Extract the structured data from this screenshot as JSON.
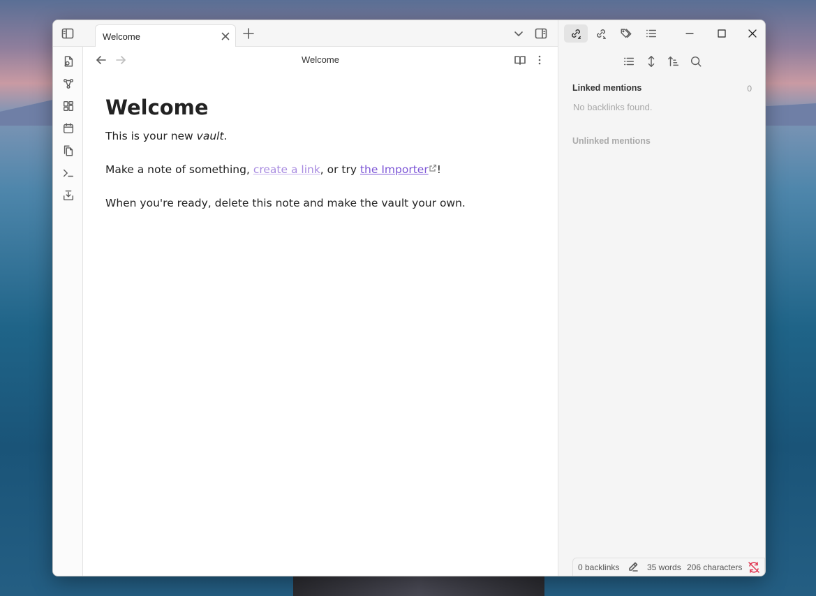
{
  "tabs": [
    {
      "title": "Welcome"
    }
  ],
  "editor": {
    "view_title": "Welcome",
    "heading": "Welcome",
    "p1_text": "This is your new ",
    "p1_em": "vault",
    "p1_end": ".",
    "p2_start": "Make a note of something, ",
    "p2_internal_link": "create a link",
    "p2_mid": ", or try ",
    "p2_external_link": "the Importer",
    "p2_end": "!",
    "p3": "When you're ready, delete this note and make the vault your own."
  },
  "backlinks_panel": {
    "linked_title": "Linked mentions",
    "linked_count": "0",
    "linked_empty": "No backlinks found.",
    "unlinked_title": "Unlinked mentions"
  },
  "statusbar": {
    "backlinks": "0 backlinks",
    "words": "35 words",
    "characters": "206 characters"
  },
  "icons": {
    "ribbon": [
      "switcher-icon",
      "graph-icon",
      "canvas-icon",
      "daily-note-icon",
      "templates-icon",
      "command-palette-icon",
      "importer-icon"
    ],
    "right_tabs": [
      "backlinks-icon",
      "outgoing-links-icon",
      "tags-icon",
      "outline-icon"
    ]
  },
  "colors": {
    "accent": "#7c55d6",
    "internal_link": "#a88be0",
    "sync_error": "#e0334e"
  }
}
